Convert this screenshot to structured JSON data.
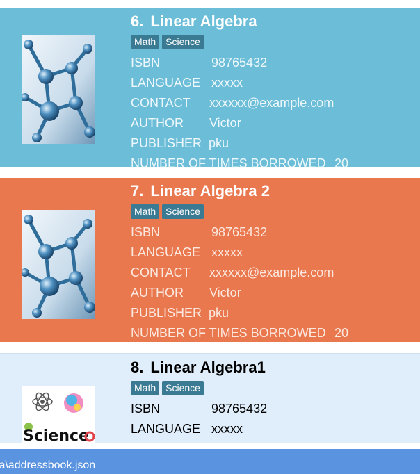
{
  "books": [
    {
      "index": "6.",
      "title": "Linear Algebra",
      "tags": [
        "Math",
        "Science"
      ],
      "isbn_label": "ISBN",
      "isbn": "98765432",
      "language_label": "LANGUAGE",
      "language": "xxxxx",
      "contact_label": "CONTACT",
      "contact": "xxxxxx@example.com",
      "author_label": "AUTHOR",
      "author": "Victor",
      "publisher_label": "PUBLISHER",
      "publisher": "pku",
      "borrowed_label": "NUMBER OF TIMES BORROWED",
      "borrowed": "20",
      "cover": "molecule-cover-image",
      "color": "#6bbdd8"
    },
    {
      "index": "7.",
      "title": "Linear Algebra 2",
      "tags": [
        "Math",
        "Science"
      ],
      "isbn_label": "ISBN",
      "isbn": "98765432",
      "language_label": "LANGUAGE",
      "language": "xxxxx",
      "contact_label": "CONTACT",
      "contact": "xxxxxx@example.com",
      "author_label": "AUTHOR",
      "author": "Victor",
      "publisher_label": "PUBLISHER",
      "publisher": "pku",
      "borrowed_label": "NUMBER OF TIMES BORROWED",
      "borrowed": "20",
      "cover": "molecule-cover-image",
      "color": "#ea784f"
    },
    {
      "index": "8.",
      "title": "Linear Algebra1",
      "tags": [
        "Math",
        "Science"
      ],
      "isbn_label": "ISBN",
      "isbn": "98765432",
      "language_label": "LANGUAGE",
      "language": "xxxxx",
      "cover": "science-cover-image",
      "cover_text": "Science",
      "color": "#e0eefb"
    }
  ],
  "tag_color": "#3b7a93",
  "status_bar": {
    "text": "ta\\addressbook.json",
    "color": "#5a93df"
  }
}
